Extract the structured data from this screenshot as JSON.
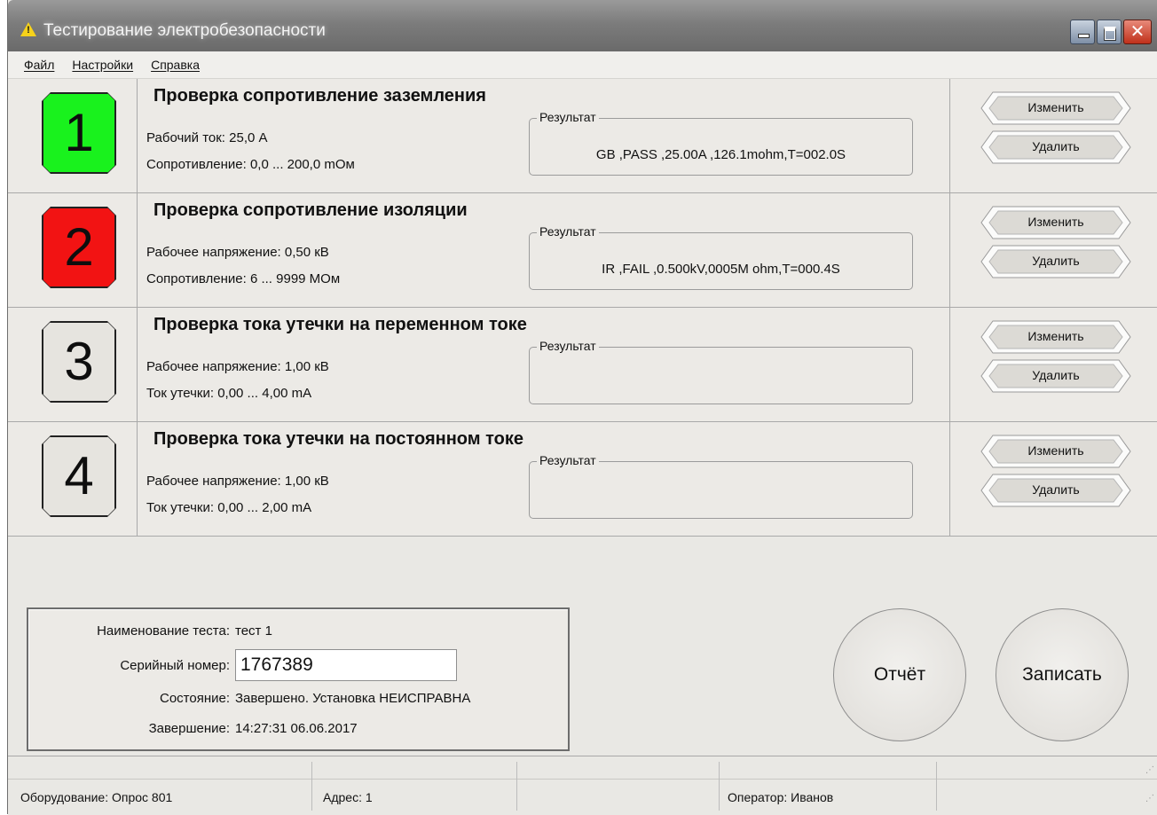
{
  "window": {
    "title": "Тестирование электробезопасности",
    "close_glyph": "✕"
  },
  "menu": {
    "file": "Файл",
    "settings": "Настройки",
    "help": "Справка"
  },
  "tests": [
    {
      "number": "1",
      "status_color": "#19f21d",
      "title": "Проверка сопротивление заземления",
      "param1": "Рабочий ток:  25,0 A",
      "param2": "Сопротивление:  0,0 ... 200,0 mОм",
      "result_label": "Результат",
      "result": "GB ,PASS ,25.00A ,126.1mohm,T=002.0S",
      "edit_label": "Изменить",
      "delete_label": "Удалить"
    },
    {
      "number": "2",
      "status_color": "#f21313",
      "title": "Проверка сопротивление изоляции",
      "param1": "Рабочее напряжение:  0,50 кВ",
      "param2": "Сопротивление:  6 ... 9999 MОм",
      "result_label": "Результат",
      "result": "IR ,FAIL ,0.500kV,0005M ohm,T=000.4S",
      "edit_label": "Изменить",
      "delete_label": "Удалить"
    },
    {
      "number": "3",
      "status_color": "#e6e4df",
      "title": "Проверка тока утечки на переменном токе",
      "param1": "Рабочее напряжение:  1,00 кВ",
      "param2": "Ток утечки:  0,00 ... 4,00 mA",
      "result_label": "Результат",
      "result": "",
      "edit_label": "Изменить",
      "delete_label": "Удалить"
    },
    {
      "number": "4",
      "status_color": "#e6e4df",
      "title": "Проверка тока утечки на постоянном  токе",
      "param1": "Рабочее напряжение:  1,00 кВ",
      "param2": "Ток утечки:  0,00 ... 2,00 mA",
      "result_label": "Результат",
      "result": "",
      "edit_label": "Изменить",
      "delete_label": "Удалить"
    }
  ],
  "info": {
    "test_name_label": "Наименование теста:",
    "test_name": "тест 1",
    "serial_label": "Серийный номер:",
    "serial_value": "1767389",
    "state_label": "Состояние:",
    "state": "Завершено. Установка НЕИСПРАВНА",
    "finish_label": "Завершение:",
    "finish": "14:27:31 06.06.2017"
  },
  "actions": {
    "report": "Отчёт",
    "save": "Записать"
  },
  "statusbar": {
    "equipment": "Оборудование: Опрос 801",
    "address": "Адрес: 1",
    "operator": "Оператор: Иванов"
  }
}
